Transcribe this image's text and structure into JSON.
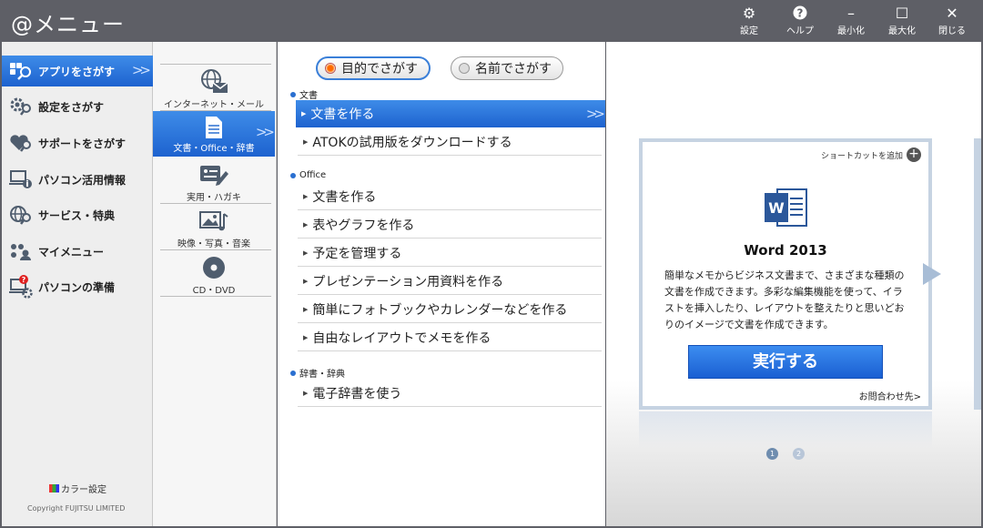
{
  "window": {
    "title": "@メニュー",
    "controls": [
      {
        "name": "settings",
        "icon": "gear-icon",
        "glyph": "⚙",
        "label": "設定"
      },
      {
        "name": "help",
        "icon": "help-icon",
        "glyph": "?",
        "label": "ヘルプ"
      },
      {
        "name": "minimize",
        "icon": "minimize-icon",
        "glyph": "–",
        "label": "最小化"
      },
      {
        "name": "maximize",
        "icon": "maximize-icon",
        "glyph": "☐",
        "label": "最大化"
      },
      {
        "name": "close",
        "icon": "close-icon",
        "glyph": "✕",
        "label": "閉じる"
      }
    ]
  },
  "sidebar": {
    "items": [
      {
        "label": "アプリをさがす",
        "icon": "app-search-icon",
        "active": true
      },
      {
        "label": "設定をさがす",
        "icon": "settings-search-icon",
        "active": false
      },
      {
        "label": "サポートをさがす",
        "icon": "support-search-icon",
        "active": false
      },
      {
        "label": "パソコン活用情報",
        "icon": "pc-info-icon",
        "active": false
      },
      {
        "label": "サービス・特典",
        "icon": "service-globe-icon",
        "active": false
      },
      {
        "label": "マイメニュー",
        "icon": "my-menu-icon",
        "active": false
      },
      {
        "label": "パソコンの準備",
        "icon": "pc-setup-icon",
        "active": false
      }
    ],
    "color_setting": "カラー設定",
    "copyright": "Copyright FUJITSU LIMITED"
  },
  "categories": {
    "items": [
      {
        "label": "インターネット・メール",
        "icon": "internet-mail-icon",
        "active": false
      },
      {
        "label": "文書・Office・辞書",
        "icon": "document-icon",
        "active": true
      },
      {
        "label": "実用・ハガキ",
        "icon": "postcard-icon",
        "active": false
      },
      {
        "label": "映像・写真・音楽",
        "icon": "photo-music-icon",
        "active": false
      },
      {
        "label": "CD・DVD",
        "icon": "disc-icon",
        "active": false
      }
    ]
  },
  "search_mode": {
    "by_purpose": "目的でさがす",
    "by_name": "名前でさがす",
    "selected": "by_purpose"
  },
  "sections": [
    {
      "title": "文書",
      "items": [
        {
          "label": "文書を作る",
          "active": true
        },
        {
          "label": "ATOKの試用版をダウンロードする",
          "active": false
        }
      ]
    },
    {
      "title": "Office",
      "items": [
        {
          "label": "文書を作る",
          "active": false
        },
        {
          "label": "表やグラフを作る",
          "active": false
        },
        {
          "label": "予定を管理する",
          "active": false
        },
        {
          "label": "プレゼンテーション用資料を作る",
          "active": false
        },
        {
          "label": "簡単にフォトブックやカレンダーなどを作る",
          "active": false
        },
        {
          "label": "自由なレイアウトでメモを作る",
          "active": false
        }
      ]
    },
    {
      "title": "辞書・辞典",
      "items": [
        {
          "label": "電子辞書を使う",
          "active": false
        }
      ]
    }
  ],
  "detail": {
    "shortcut_label": "ショートカットを追加",
    "app_name": "Word 2013",
    "app_icon": "word-icon",
    "description": "簡単なメモからビジネス文書まで、さまざまな種類の文書を作成できます。多彩な編集機能を使って、イラストを挿入したり、レイアウトを整えたりと思いどおりのイメージで文書を作成できます。",
    "run_label": "実行する",
    "contact_label": "お問合わせ先>",
    "pages": [
      "1",
      "2"
    ],
    "current_page": 1
  },
  "colors": {
    "titlebar": "#5e5f66",
    "accent_blue": "#1d62cf",
    "accent_blue_light": "#3e8ce8",
    "word_blue": "#2b579a",
    "radio_orange": "#ff6a00"
  }
}
